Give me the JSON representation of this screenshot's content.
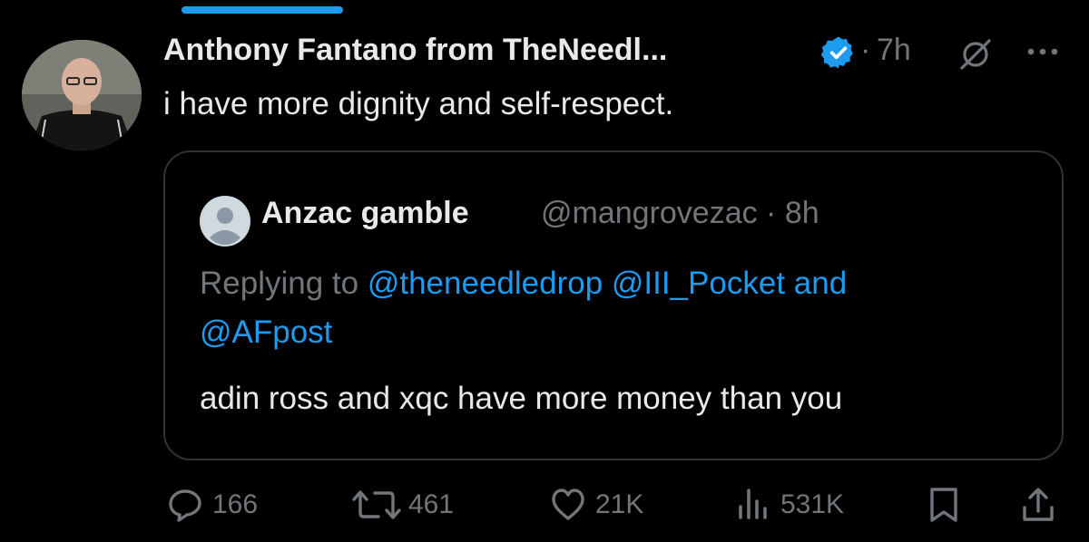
{
  "tweet": {
    "author_name": "Anthony Fantano from TheNeedl...",
    "separator": "·",
    "time": "7h",
    "text": "i have more dignity and self-respect."
  },
  "quote": {
    "author_name": "Anzac gamble",
    "handle_time": "@mangrovezac · 8h",
    "replying_to_prefix": "Replying to ",
    "mention_1": "@theneedledrop",
    "mention_2": "@III_Pocket",
    "conjunction": " and",
    "mention_3": "@AFpost",
    "text": "adin ross and xqc have more money than you"
  },
  "actions": {
    "replies": "166",
    "reposts": "461",
    "likes": "21K",
    "views": "531K"
  },
  "icons": {
    "verified": "verified-badge-icon",
    "grok": "grok-icon",
    "more": "more-icon",
    "reply": "reply-icon",
    "repost": "repost-icon",
    "like": "heart-icon",
    "views": "views-icon",
    "bookmark": "bookmark-icon",
    "share": "share-icon"
  },
  "colors": {
    "background": "#000000",
    "text": "#e7e9ea",
    "secondary": "#71767b",
    "accent": "#1d9bf0",
    "border": "#2f3336"
  }
}
